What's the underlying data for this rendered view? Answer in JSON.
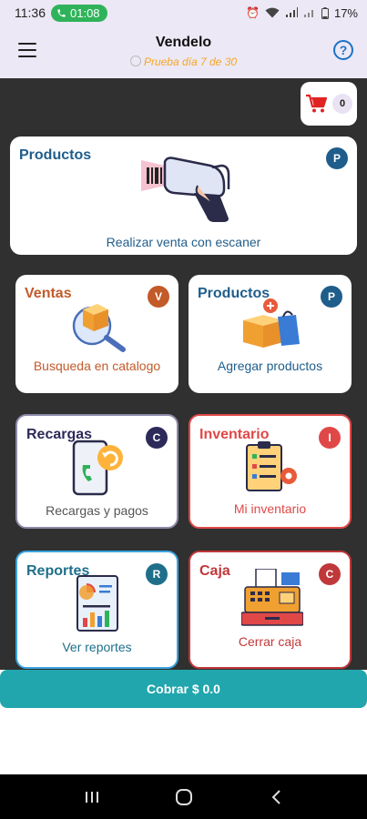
{
  "status_bar": {
    "time": "11:36",
    "call_time": "01:08",
    "battery": "17%"
  },
  "app_bar": {
    "title": "Vendelo",
    "trial": "Prueba día 7 de 30"
  },
  "cart": {
    "count": "0"
  },
  "cards": {
    "scan": {
      "title": "Productos",
      "badge": "P",
      "label": "Realizar venta con escaner"
    },
    "ventas": {
      "title": "Ventas",
      "badge": "V",
      "label": "Busqueda en catalogo"
    },
    "productos": {
      "title": "Productos",
      "badge": "P",
      "label": "Agregar productos"
    },
    "recargas": {
      "title": "Recargas",
      "badge": "C",
      "label": "Recargas y pagos"
    },
    "inventario": {
      "title": "Inventario",
      "badge": "I",
      "label": "Mi inventario"
    },
    "reportes": {
      "title": "Reportes",
      "badge": "R",
      "label": "Ver reportes"
    },
    "caja": {
      "title": "Caja",
      "badge": "C",
      "label": "Cerrar caja"
    }
  },
  "cobrar": {
    "label": "Cobrar $ 0.0"
  },
  "colors": {
    "accent_teal": "#21a6ad",
    "ventas": "#c25a2a",
    "inventario": "#e04848",
    "caja": "#c0383a",
    "recargas": "#2d2a5a",
    "productos": "#1f5d8b",
    "reportes": "#1f6f8b"
  }
}
